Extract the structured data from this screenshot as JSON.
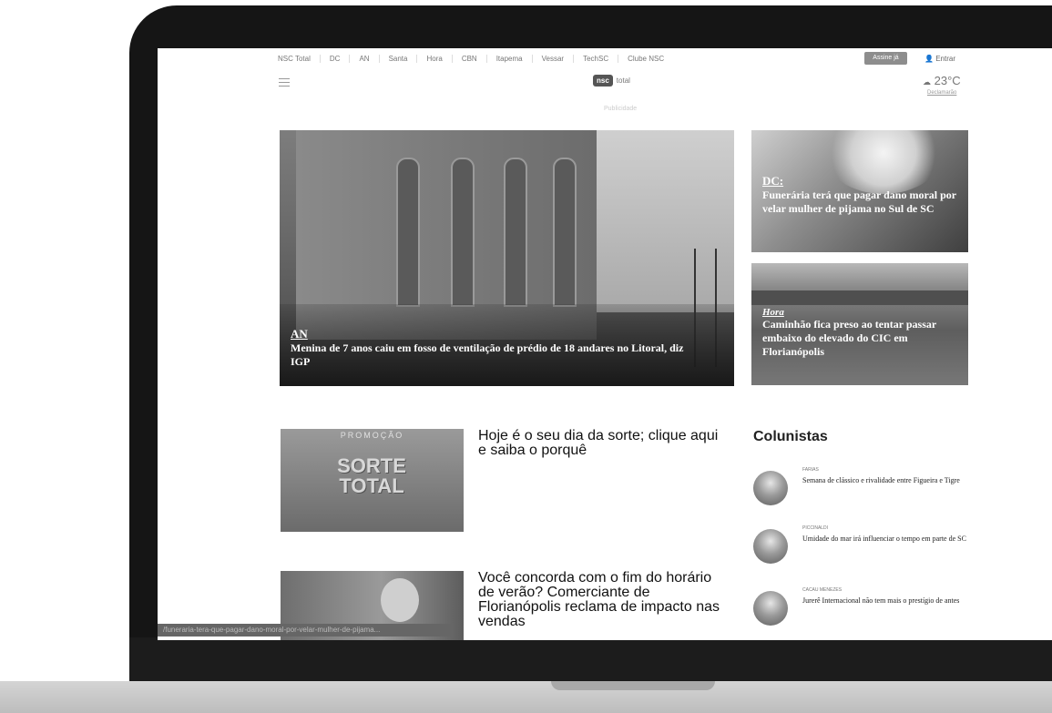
{
  "topnav": [
    "NSC Total",
    "DC",
    "AN",
    "Santa",
    "Hora",
    "CBN",
    "Itapema",
    "Vessar",
    "TechSC",
    "Clube NSC"
  ],
  "header": {
    "subscribe_label": "Assine já",
    "login_label": "Entrar",
    "logo_mark": "nsc",
    "logo_word": "total",
    "temperature": "23°C",
    "location": "Declamarão",
    "ad_label": "Publicidade"
  },
  "hero": {
    "tag": "AN",
    "title": "Menina de 7 anos caiu em fosso de ventilação de prédio de 18 andares no Litoral, diz IGP"
  },
  "side_stories": [
    {
      "tag": "DC:",
      "title": "Funerária terá que pagar dano moral por velar mulher de pijama no Sul de SC"
    },
    {
      "tag": "Hora",
      "title": "Caminhão fica preso ao tentar passar embaixo do elevado do CIC em Florianópolis"
    }
  ],
  "stories": [
    {
      "promo": "PROMOÇÃO",
      "brand": "SORTE TOTAL",
      "title": "Hoje é o seu dia da sorte; clique aqui e saiba o porquê"
    },
    {
      "title": "Você concorda com o fim do horário de verão? Comerciante de Florianópolis reclama de impacto nas vendas"
    }
  ],
  "columnists": {
    "title": "Colunistas",
    "items": [
      {
        "author": "Farias",
        "headline": "Semana de clássico e rivalidade entre Figueira e Tigre"
      },
      {
        "author": "Piccinaldi",
        "headline": "Umidade do mar irá influenciar o tempo em parte de SC"
      },
      {
        "author": "Cacau Menezes",
        "headline": "Jurerê Internacional não tem mais o prestígio de antes"
      }
    ]
  },
  "status_url": "/funeraria-tera-que-pagar-dano-moral-por-velar-mulher-de-pijama..."
}
